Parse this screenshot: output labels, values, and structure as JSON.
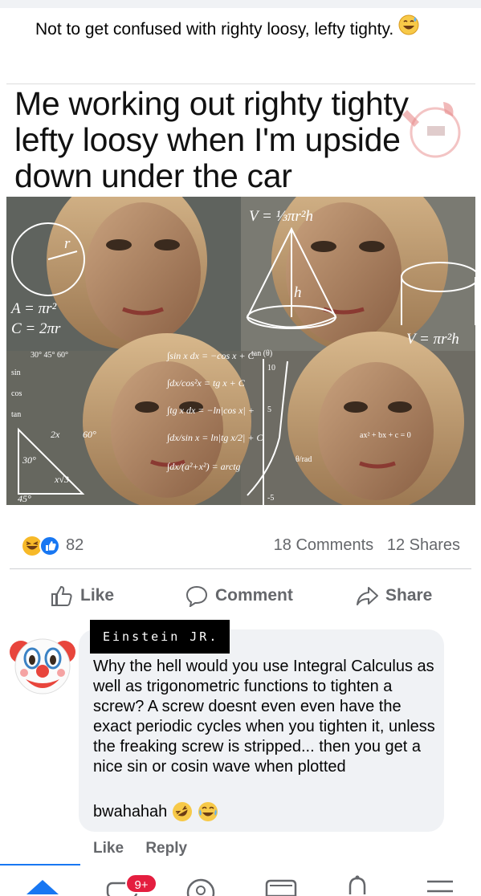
{
  "post": {
    "caption": "Not to get confused with righty loosy, lefty tighty."
  },
  "meme": {
    "title": "Me working out righty tighty lefty loosy when I'm upside down under the car",
    "formulas": {
      "volume_cone": "V = ⅓πr²h",
      "area": "A = πr²",
      "circumference": "C = 2πr",
      "volume_cylinder": "V = πr²h",
      "angles_header": "30°  45°  60°",
      "sin": "sin",
      "cos": "cos",
      "tan": "tan",
      "integral1": "∫sin x dx = −cos x + C",
      "integral2": "∫dx/cos²x = tg x + C",
      "integral3": "∫tg x dx = −ln|cos x| +",
      "integral4": "∫dx/sin x = ln|tg x/2| + C",
      "integral5": "∫dx/(a²+x²) = arctg",
      "tan_theta": "tan (θ)",
      "tick10": "10",
      "tick5": "5",
      "tickn5": "-5",
      "theta_rad": "θ/rad",
      "quad1": "ax² + bx + c = 0",
      "label_2x": "2x",
      "label_60": "60°",
      "label_30": "30°",
      "label_xv3": "x√3",
      "label_45": "45°",
      "label_h": "h",
      "label_r": "r"
    }
  },
  "stats": {
    "reaction_count": "82",
    "comments": "18 Comments",
    "shares": "12 Shares"
  },
  "actions": {
    "like": "Like",
    "comment": "Comment",
    "share": "Share"
  },
  "comment": {
    "author": "Einstein JR.",
    "text": "Why the hell would you use Integral Calculus as well as trigonometric functions to tighten a screw? A screw doesnt even even have the exact periodic cycles when you tighten it, unless the freaking screw is stripped... then you get a nice sin or cosin wave when plotted",
    "tail": "bwahahah",
    "like": "Like",
    "reply": "Reply"
  },
  "nav": {
    "badge": "9+"
  },
  "colors": {
    "brand_blue": "#1877f2",
    "bubble_bg": "#f0f2f5",
    "muted_text": "#65676b",
    "badge_red": "#e41e3f"
  }
}
